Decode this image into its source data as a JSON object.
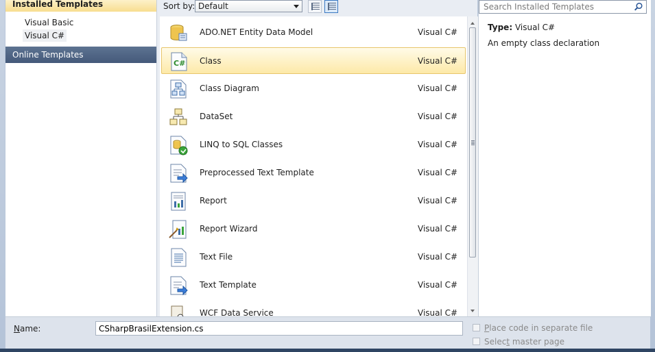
{
  "tree": {
    "header": "Installed Templates",
    "items": [
      "Visual Basic",
      "Visual C#"
    ],
    "selected_index": 1,
    "online": "Online Templates"
  },
  "toolbar": {
    "sort_label": "Sort by:",
    "sort_value": "Default"
  },
  "templates": [
    {
      "name": "ADO.NET Entity Data Model",
      "lang": "Visual C#",
      "icon": "entity-data-model-icon"
    },
    {
      "name": "Class",
      "lang": "Visual C#",
      "icon": "class-cs-icon",
      "selected": true
    },
    {
      "name": "Class Diagram",
      "lang": "Visual C#",
      "icon": "class-diagram-icon"
    },
    {
      "name": "DataSet",
      "lang": "Visual C#",
      "icon": "dataset-icon"
    },
    {
      "name": "LINQ to SQL Classes",
      "lang": "Visual C#",
      "icon": "linq-to-sql-icon"
    },
    {
      "name": "Preprocessed Text Template",
      "lang": "Visual C#",
      "icon": "preprocessed-template-icon"
    },
    {
      "name": "Report",
      "lang": "Visual C#",
      "icon": "report-icon"
    },
    {
      "name": "Report Wizard",
      "lang": "Visual C#",
      "icon": "report-wizard-icon"
    },
    {
      "name": "Text File",
      "lang": "Visual C#",
      "icon": "text-file-icon"
    },
    {
      "name": "Text Template",
      "lang": "Visual C#",
      "icon": "text-template-icon"
    },
    {
      "name": "WCF Data Service",
      "lang": "Visual C#",
      "icon": "wcf-data-service-icon"
    }
  ],
  "details": {
    "search_placeholder": "Search Installed Templates",
    "type_label": "Type:",
    "type_value": "Visual C#",
    "description": "An empty class declaration"
  },
  "bottom": {
    "name_label_prefix": "N",
    "name_label_rest": "ame:",
    "name_value": "CSharpBrasilExtension.cs",
    "place_code": {
      "first": "P",
      "rest": "lace code in separate file"
    },
    "select_master": {
      "prefix": "Selec",
      "underlined": "t",
      "rest": " master page"
    }
  }
}
